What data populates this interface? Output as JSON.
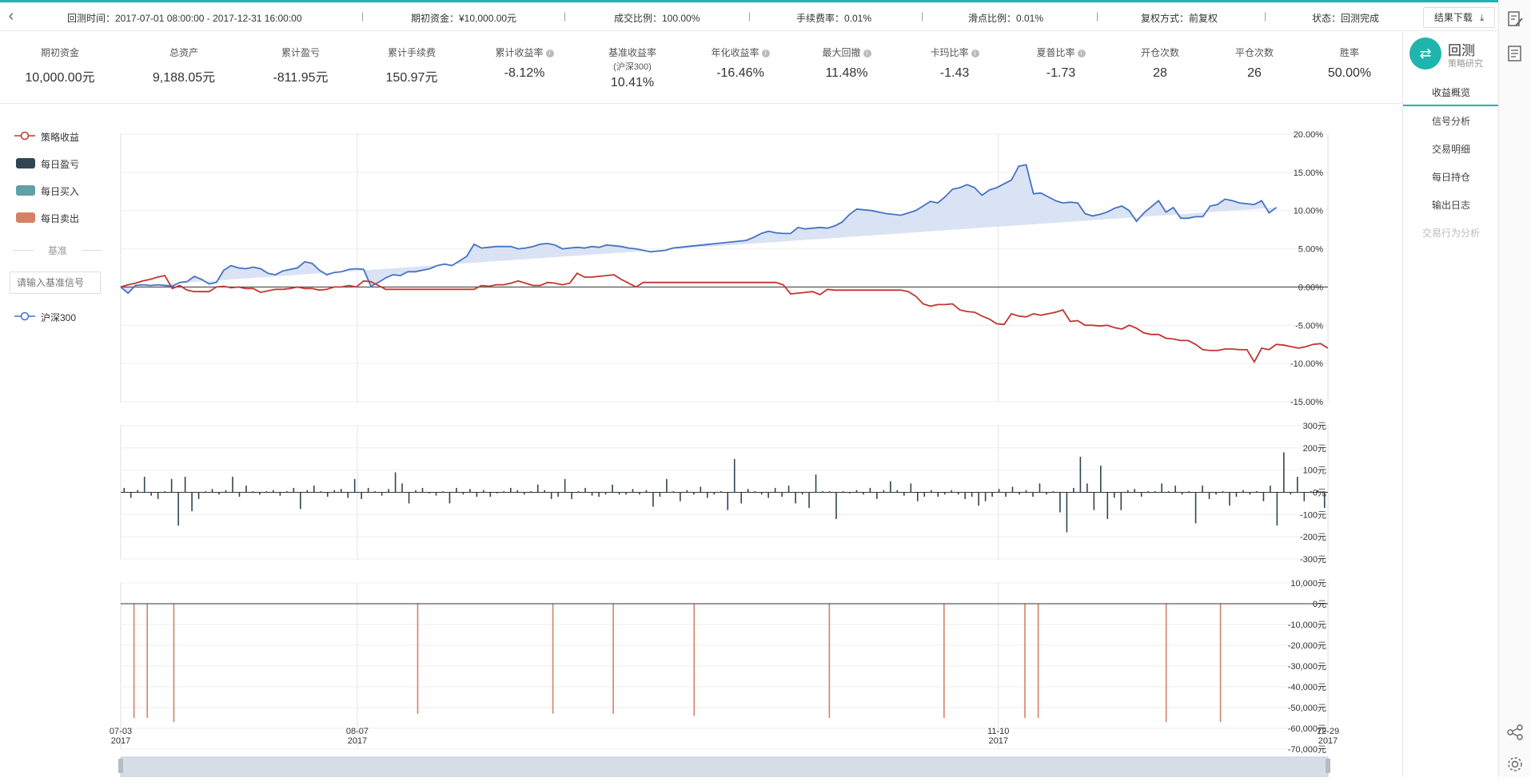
{
  "infobar": {
    "back_icon": "chevron-left-icon",
    "period": "回测时间：2017-07-01 08:00:00 - 2017-12-31 16:00:00",
    "capital": "期初资金：¥10,000.00元",
    "deal_ratio": "成交比例：100.00%",
    "fee_rate": "手续费率：0.01%",
    "slippage": "滑点比例：0.01%",
    "adjust": "复权方式：前复权",
    "status": "状态：回测完成",
    "download_label": "结果下载",
    "download_icon": "download-icon"
  },
  "stats": [
    {
      "label": "期初资金",
      "value": "10,000.00元",
      "info": false
    },
    {
      "label": "总资产",
      "value": "9,188.05元",
      "info": false
    },
    {
      "label": "累计盈亏",
      "value": "-811.95元",
      "info": false
    },
    {
      "label": "累计手续费",
      "value": "150.97元",
      "info": false
    },
    {
      "label": "累计收益率",
      "value": "-8.12%",
      "info": true
    },
    {
      "label": "基准收益率",
      "sub": "(沪深300)",
      "value": "10.41%",
      "info": false
    },
    {
      "label": "年化收益率",
      "value": "-16.46%",
      "info": true
    },
    {
      "label": "最大回撤",
      "value": "11.48%",
      "info": true
    },
    {
      "label": "卡玛比率",
      "value": "-1.43",
      "info": true
    },
    {
      "label": "夏普比率",
      "value": "-1.73",
      "info": true
    },
    {
      "label": "开仓次数",
      "value": "28",
      "info": false
    },
    {
      "label": "平仓次数",
      "value": "26",
      "info": false
    },
    {
      "label": "胜率",
      "value": "50.00%",
      "info": false
    }
  ],
  "right_panel": {
    "logo_title": "回测",
    "logo_subtitle": "策略研究",
    "nav": [
      "收益概览",
      "信号分析",
      "交易明细",
      "每日持仓",
      "输出日志",
      "交易行为分析"
    ],
    "active_nav": 0,
    "disabled_nav": 5
  },
  "far_right_icons": [
    "edit-icon",
    "document-icon",
    "share-icon",
    "settings-icon"
  ],
  "legend": {
    "items": [
      {
        "label": "策略收益",
        "color": "#c23531"
      },
      {
        "label": "每日盈亏",
        "color": "#2f4554"
      },
      {
        "label": "每日买入",
        "color": "#61a0a8"
      },
      {
        "label": "每日卖出",
        "color": "#d48265"
      }
    ],
    "benchmark_title": "基准",
    "benchmark_placeholder": "请输入基准信号",
    "benchmark_item": {
      "label": "沪深300",
      "color": "#4472c4"
    }
  },
  "chart_data": [
    {
      "type": "line",
      "name": "returns",
      "ylim": [
        -15,
        20
      ],
      "yticks": [
        "20.00%",
        "15.00%",
        "10.00%",
        "5.00%",
        "0.00%",
        "-5.00%",
        "-10.00%",
        "-15.00%"
      ],
      "series": [
        {
          "name": "策略收益",
          "color": "#c23531",
          "values": [
            0.0,
            0.3,
            0.5,
            0.8,
            1.0,
            1.3,
            1.5,
            -0.2,
            0.2,
            -0.4,
            -0.6,
            -0.6,
            -0.6,
            0.0,
            0.1,
            -0.1,
            0.0,
            -0.2,
            -0.2,
            -0.7,
            -0.5,
            -0.3,
            -0.3,
            -0.2,
            0.0,
            -0.2,
            -0.2,
            -0.4,
            -0.3,
            0.0,
            0.0,
            0.2,
            0.0,
            0.8,
            0.7,
            0.2,
            -0.3,
            -0.3,
            -0.3,
            -0.3,
            -0.3,
            -0.3,
            -0.3,
            -0.3,
            -0.3,
            -0.3,
            -0.3,
            -0.3,
            -0.3,
            0.2,
            0.1,
            0.3,
            0.3,
            0.5,
            0.8,
            0.5,
            0.2,
            0.2,
            0.6,
            0.5,
            0.3,
            0.5,
            1.8,
            1.3,
            1.3,
            1.4,
            1.5,
            1.6,
            1.0,
            0.5,
            0.0,
            0.6,
            0.6,
            0.6,
            0.6,
            0.6,
            0.6,
            0.6,
            0.6,
            0.6,
            0.6,
            0.6,
            0.6,
            0.6,
            0.6,
            0.6,
            0.6,
            0.6,
            0.6,
            0.6,
            0.3,
            -0.9,
            -0.8,
            -0.7,
            -0.6,
            -1.0,
            -0.3,
            -0.4,
            -0.4,
            -0.4,
            -0.4,
            -0.4,
            -0.4,
            -0.4,
            -0.4,
            -0.4,
            -0.4,
            -0.6,
            -1.2,
            -2.2,
            -2.5,
            -2.3,
            -2.3,
            -2.2,
            -3.0,
            -3.2,
            -3.3,
            -3.8,
            -4.2,
            -4.8,
            -4.9,
            -3.5,
            -3.8,
            -3.9,
            -3.5,
            -3.7,
            -3.5,
            -3.3,
            -3.0,
            -4.5,
            -4.4,
            -5.0,
            -5.0,
            -5.1,
            -5.0,
            -5.3,
            -5.5,
            -5.0,
            -5.4,
            -6.0,
            -6.2,
            -6.2,
            -6.7,
            -6.8,
            -7.0,
            -7.0,
            -7.5,
            -8.2,
            -8.3,
            -8.3,
            -8.1,
            -8.1,
            -8.2,
            -8.2,
            -9.8,
            -8.0,
            -8.2,
            -7.5,
            -7.6,
            -7.8,
            -8.0,
            -7.8,
            -7.5,
            -7.4,
            -8.0
          ]
        },
        {
          "name": "沪深300",
          "color": "#4472c4",
          "values": [
            0.0,
            -0.8,
            0.2,
            0.3,
            0.2,
            0.3,
            0.2,
            0.1,
            0.6,
            0.7,
            1.4,
            1.0,
            0.4,
            0.6,
            2.2,
            2.8,
            2.5,
            2.4,
            2.6,
            2.4,
            1.8,
            1.6,
            2.1,
            2.3,
            2.5,
            3.3,
            3.1,
            2.2,
            1.6,
            1.9,
            2.0,
            2.3,
            2.4,
            2.3,
            0.1,
            0.6,
            1.2,
            1.6,
            1.5,
            2.0,
            2.0,
            2.2,
            2.4,
            2.8,
            3.0,
            2.8,
            3.4,
            4.0,
            5.6,
            5.1,
            5.2,
            5.3,
            5.3,
            5.3,
            5.0,
            5.1,
            5.3,
            5.6,
            5.7,
            5.5,
            5.0,
            5.1,
            5.2,
            5.1,
            5.3,
            5.2,
            5.5,
            5.4,
            5.3,
            5.1,
            5.0,
            4.8,
            4.6,
            4.7,
            4.8,
            5.1,
            5.2,
            5.3,
            5.4,
            5.5,
            5.6,
            5.7,
            5.8,
            5.9,
            6.0,
            6.1,
            6.5,
            7.0,
            7.3,
            7.1,
            7.0,
            7.0,
            7.8,
            7.6,
            7.7,
            7.8,
            7.7,
            8.0,
            8.5,
            9.5,
            10.2,
            10.1,
            10.0,
            9.8,
            9.6,
            9.5,
            9.4,
            9.7,
            10.0,
            10.6,
            11.2,
            11.0,
            11.8,
            12.8,
            13.0,
            13.4,
            13.0,
            12.0,
            12.7,
            13.0,
            13.5,
            14.0,
            15.8,
            16.0,
            12.2,
            12.3,
            11.8,
            11.3,
            11.0,
            11.1,
            11.0,
            9.6,
            9.3,
            9.5,
            9.8,
            10.3,
            10.6,
            10.0,
            8.6,
            9.7,
            10.5,
            11.3,
            9.8,
            10.4,
            9.0,
            9.0,
            9.2,
            9.2,
            10.6,
            10.8,
            11.5,
            11.3,
            11.0,
            10.9,
            10.8,
            11.3,
            9.7,
            10.4
          ]
        }
      ],
      "xticks": [
        {
          "pos": 0,
          "line1": "07-03",
          "line2": "2017"
        },
        {
          "pos": 0.196,
          "line1": "08-07",
          "line2": "2017"
        },
        {
          "pos": 0.727,
          "line1": "11-10",
          "line2": "2017"
        },
        {
          "pos": 1,
          "line1": "12-29",
          "line2": "2017"
        }
      ]
    },
    {
      "type": "bar",
      "name": "daily_pnl",
      "ylim": [
        -300,
        300
      ],
      "yticks": [
        "300元",
        "200元",
        "100元",
        "0元",
        "-100元",
        "-200元",
        "-300元"
      ],
      "color": "#2f4554",
      "values": [
        20,
        -25,
        10,
        70,
        -15,
        -30,
        5,
        60,
        -150,
        70,
        -85,
        -30,
        5,
        15,
        -10,
        10,
        70,
        -20,
        30,
        5,
        -10,
        5,
        10,
        -15,
        5,
        20,
        -75,
        10,
        30,
        5,
        -20,
        10,
        15,
        -25,
        60,
        -30,
        20,
        5,
        -15,
        15,
        90,
        40,
        -50,
        10,
        20,
        -5,
        -15,
        5,
        -50,
        20,
        -10,
        15,
        -20,
        10,
        -20,
        -5,
        5,
        20,
        10,
        -10,
        5,
        35,
        10,
        -30,
        -20,
        60,
        -30,
        5,
        20,
        -15,
        -20,
        -10,
        35,
        -10,
        -10,
        15,
        -10,
        10,
        -65,
        -20,
        60,
        5,
        -40,
        10,
        -10,
        25,
        -25,
        -10,
        5,
        -80,
        150,
        -50,
        15,
        5,
        -10,
        -25,
        20,
        -20,
        30,
        -50,
        -10,
        -70,
        80,
        5,
        5,
        -120,
        5,
        -5,
        10,
        -10,
        20,
        -30,
        10,
        50,
        10,
        -15,
        40,
        -40,
        -20,
        10,
        -20,
        -10,
        10,
        -10,
        -30,
        -20,
        -60,
        -40,
        -20,
        15,
        -20,
        25,
        -10,
        10,
        -20,
        40,
        -10,
        5,
        -90,
        -180,
        20,
        160,
        40,
        -80,
        120,
        -120,
        -25,
        -80,
        10,
        15,
        -20,
        5,
        5,
        40,
        5,
        30,
        -10,
        5,
        -140,
        30,
        -30,
        -10,
        5,
        -60,
        -20,
        10,
        -10,
        5,
        -40,
        30,
        -150,
        180,
        -10,
        70,
        -40,
        5,
        10,
        -70
      ]
    },
    {
      "type": "bar",
      "name": "daily_trades",
      "ylim": [
        -70000,
        10000
      ],
      "yticks": [
        "10,000元",
        "0元",
        "-10,000元",
        "-20,000元",
        "-30,000元",
        "-40,000元",
        "-50,000元",
        "-60,000元",
        "-70,000元"
      ],
      "color": "#d48265",
      "values": [
        {
          "pos": 0.011,
          "value": -55000
        },
        {
          "pos": 0.022,
          "value": -55000
        },
        {
          "pos": 0.044,
          "value": -57000
        },
        {
          "pos": 0.246,
          "value": -53000
        },
        {
          "pos": 0.358,
          "value": -53000
        },
        {
          "pos": 0.408,
          "value": -53000
        },
        {
          "pos": 0.475,
          "value": -54000
        },
        {
          "pos": 0.587,
          "value": -55000
        },
        {
          "pos": 0.682,
          "value": -55000
        },
        {
          "pos": 0.749,
          "value": -55000
        },
        {
          "pos": 0.76,
          "value": -55000
        },
        {
          "pos": 0.866,
          "value": -57000
        },
        {
          "pos": 0.911,
          "value": -57000
        }
      ]
    }
  ]
}
